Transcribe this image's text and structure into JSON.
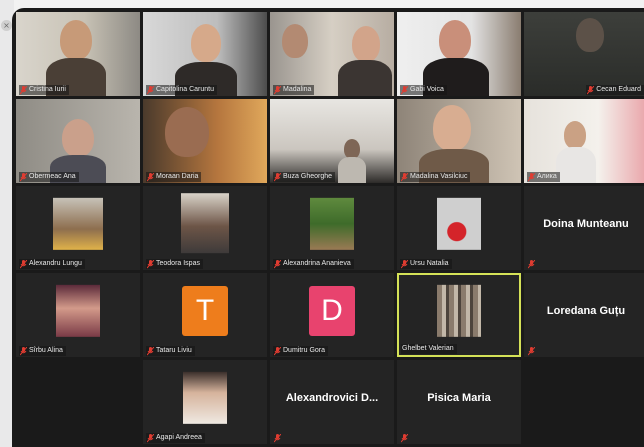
{
  "window": {
    "close_glyph": "×"
  },
  "colors": {
    "active_border": "#d4e157",
    "muted_mic": "#e03c31"
  },
  "participants": [
    {
      "name": "Cristina Iurii",
      "type": "video"
    },
    {
      "name": "Capitolina Caruntu",
      "type": "video"
    },
    {
      "name": "Madalina",
      "type": "video"
    },
    {
      "name": "Gabi Voica",
      "type": "video"
    },
    {
      "name": "Cecan Eduard",
      "type": "video"
    },
    {
      "name": "Obermeac Ana",
      "type": "video"
    },
    {
      "name": "Moraan Daria",
      "type": "video"
    },
    {
      "name": "Buza Gheorghe",
      "type": "video"
    },
    {
      "name": "Madalina Vasilciuc",
      "type": "video"
    },
    {
      "name": "Алика",
      "type": "video"
    },
    {
      "name": "Alexandru Lungu",
      "type": "photo"
    },
    {
      "name": "Teodora Ispas",
      "type": "photo"
    },
    {
      "name": "Alexandrina Ananieva",
      "type": "photo"
    },
    {
      "name": "Ursu Natalia",
      "type": "photo"
    },
    {
      "name": "Doina Munteanu",
      "type": "text"
    },
    {
      "name": "Sîrbu Alina",
      "type": "photo"
    },
    {
      "name": "Tataru Liviu",
      "type": "initial",
      "initial": "T",
      "color": "#ee7d1c"
    },
    {
      "name": "Dumitru Gora",
      "type": "initial",
      "initial": "D",
      "color": "#e8436e"
    },
    {
      "name": "Ghelbet Valerian",
      "type": "photo",
      "active": true
    },
    {
      "name": "Loredana Guțu",
      "type": "text"
    },
    {
      "name": "Agapi Andreea",
      "type": "photo"
    },
    {
      "name": "Alexandrovici D...",
      "type": "text"
    },
    {
      "name": "Pisica Maria",
      "type": "text"
    }
  ]
}
